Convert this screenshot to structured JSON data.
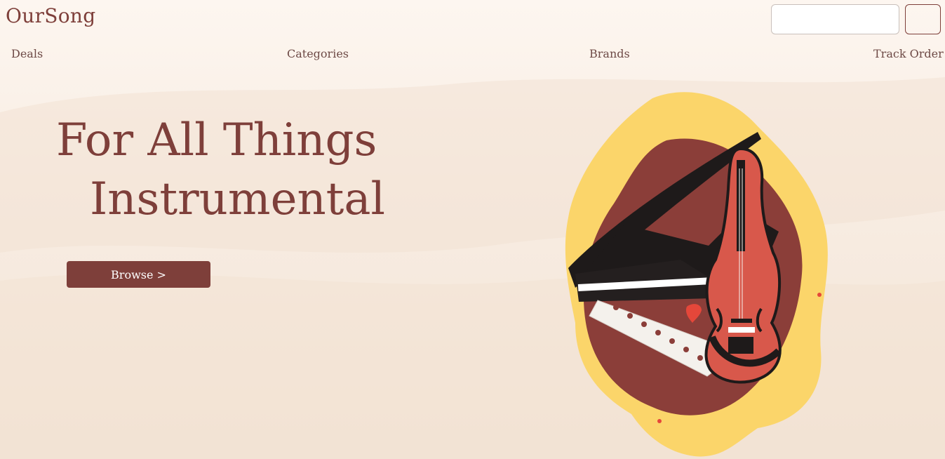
{
  "brand": {
    "name": "OurSong"
  },
  "search": {
    "value": "",
    "placeholder": ""
  },
  "nav": {
    "items": [
      "Deals",
      "Categories",
      "Brands",
      "Track Order"
    ]
  },
  "hero": {
    "title_line1": "For All Things",
    "title_line2": "Instrumental",
    "browse_label": "Browse >"
  },
  "colors": {
    "accent": "#7e3f3a",
    "yellow": "#fbd56a",
    "red": "#d8584b",
    "background": "#fdf6f0"
  },
  "illustration": {
    "icon": "piano-violin-illustration"
  }
}
